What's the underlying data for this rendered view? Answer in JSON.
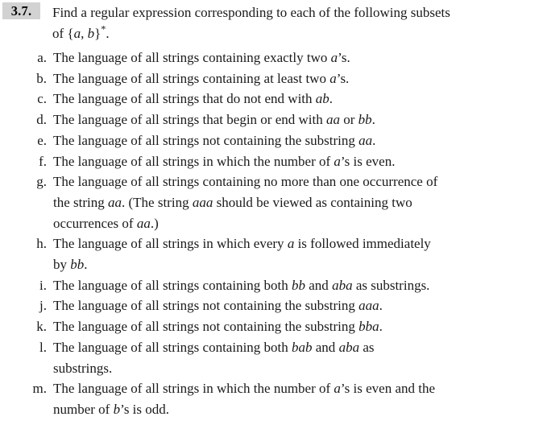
{
  "page": {
    "background_color": "#ffffff",
    "text_color": "#1a1a1a"
  },
  "problem": {
    "number": "3.7.",
    "number_chip_color": "#d2d2d2",
    "stem_line_1": "Find a regular expression corresponding to each of the following subsets",
    "stem_line_2_prefix": "of {",
    "stem_line_2_sym_a": "a",
    "stem_line_2_mid": ", ",
    "stem_line_2_sym_b": "b",
    "stem_line_2_suffix": "}",
    "stem_line_2_star": "*",
    "stem_line_2_end": "."
  },
  "items": [
    {
      "label": "a.",
      "lines": [
        {
          "parts": [
            {
              "text": "The language of all strings containing exactly two ",
              "italic": false
            },
            {
              "text": "a",
              "italic": true
            },
            {
              "text": "’s.",
              "italic": false
            }
          ]
        }
      ]
    },
    {
      "label": "b.",
      "lines": [
        {
          "parts": [
            {
              "text": "The language of all strings containing at least two ",
              "italic": false
            },
            {
              "text": "a",
              "italic": true
            },
            {
              "text": "’s.",
              "italic": false
            }
          ]
        }
      ]
    },
    {
      "label": "c.",
      "lines": [
        {
          "parts": [
            {
              "text": "The language of all strings that do not end with ",
              "italic": false
            },
            {
              "text": "ab",
              "italic": true
            },
            {
              "text": ".",
              "italic": false
            }
          ]
        }
      ]
    },
    {
      "label": "d.",
      "lines": [
        {
          "parts": [
            {
              "text": "The language of all strings that begin or end with ",
              "italic": false
            },
            {
              "text": "aa",
              "italic": true
            },
            {
              "text": " or ",
              "italic": false
            },
            {
              "text": "bb",
              "italic": true
            },
            {
              "text": ".",
              "italic": false
            }
          ]
        }
      ]
    },
    {
      "label": "e.",
      "lines": [
        {
          "parts": [
            {
              "text": "The language of all strings not containing the substring ",
              "italic": false
            },
            {
              "text": "aa",
              "italic": true
            },
            {
              "text": ".",
              "italic": false
            }
          ]
        }
      ]
    },
    {
      "label": "f.",
      "lines": [
        {
          "parts": [
            {
              "text": "The language of all strings in which the number of ",
              "italic": false
            },
            {
              "text": "a",
              "italic": true
            },
            {
              "text": "’s is even.",
              "italic": false
            }
          ]
        }
      ]
    },
    {
      "label": "g.",
      "lines": [
        {
          "parts": [
            {
              "text": "The language of all strings containing no more than one occurrence of",
              "italic": false
            }
          ]
        },
        {
          "parts": [
            {
              "text": "the string ",
              "italic": false
            },
            {
              "text": "aa",
              "italic": true
            },
            {
              "text": ". (The string ",
              "italic": false
            },
            {
              "text": "aaa",
              "italic": true
            },
            {
              "text": " should be viewed as containing two",
              "italic": false
            }
          ]
        },
        {
          "parts": [
            {
              "text": "occurrences of ",
              "italic": false
            },
            {
              "text": "aa",
              "italic": true
            },
            {
              "text": ".)",
              "italic": false
            }
          ]
        }
      ]
    },
    {
      "label": "h.",
      "lines": [
        {
          "parts": [
            {
              "text": "The language of all strings in which every ",
              "italic": false
            },
            {
              "text": "a",
              "italic": true
            },
            {
              "text": " is followed immediately",
              "italic": false
            }
          ]
        },
        {
          "parts": [
            {
              "text": "by ",
              "italic": false
            },
            {
              "text": "bb",
              "italic": true
            },
            {
              "text": ".",
              "italic": false
            }
          ]
        }
      ]
    },
    {
      "label": "i.",
      "lines": [
        {
          "parts": [
            {
              "text": "The language of all strings containing both ",
              "italic": false
            },
            {
              "text": "bb",
              "italic": true
            },
            {
              "text": " and ",
              "italic": false
            },
            {
              "text": "aba",
              "italic": true
            },
            {
              "text": " as substrings.",
              "italic": false
            }
          ]
        }
      ]
    },
    {
      "label": "j.",
      "lines": [
        {
          "parts": [
            {
              "text": "The language of all strings not containing the substring ",
              "italic": false
            },
            {
              "text": "aaa",
              "italic": true
            },
            {
              "text": ".",
              "italic": false
            }
          ]
        }
      ]
    },
    {
      "label": "k.",
      "lines": [
        {
          "parts": [
            {
              "text": "The language of all strings not containing the substring ",
              "italic": false
            },
            {
              "text": "bba",
              "italic": true
            },
            {
              "text": ".",
              "italic": false
            }
          ]
        }
      ]
    },
    {
      "label": "l.",
      "lines": [
        {
          "parts": [
            {
              "text": "The language of all strings containing both ",
              "italic": false
            },
            {
              "text": "bab",
              "italic": true
            },
            {
              "text": " and ",
              "italic": false
            },
            {
              "text": "aba",
              "italic": true
            },
            {
              "text": " as",
              "italic": false
            }
          ]
        },
        {
          "parts": [
            {
              "text": "substrings.",
              "italic": false
            }
          ]
        }
      ]
    },
    {
      "label": "m.",
      "lines": [
        {
          "parts": [
            {
              "text": "The language of all strings in which the number of ",
              "italic": false
            },
            {
              "text": "a",
              "italic": true
            },
            {
              "text": "’s is even and the",
              "italic": false
            }
          ]
        },
        {
          "parts": [
            {
              "text": "number of ",
              "italic": false
            },
            {
              "text": "b",
              "italic": true
            },
            {
              "text": "’s is odd.",
              "italic": false
            }
          ]
        }
      ]
    }
  ]
}
